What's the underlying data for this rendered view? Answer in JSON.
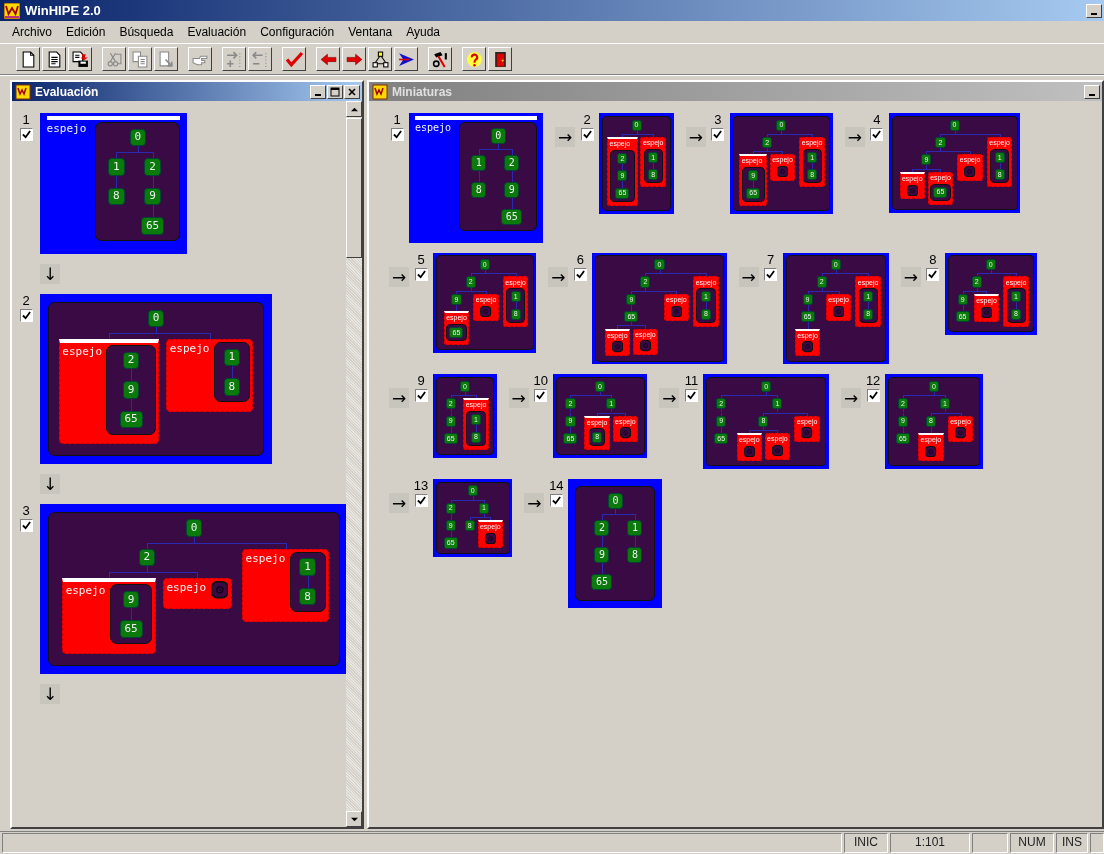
{
  "window": {
    "title": "WinHIPE 2.0"
  },
  "menu": [
    "Archivo",
    "Edición",
    "Búsqueda",
    "Evaluación",
    "Configuración",
    "Ventana",
    "Ayuda"
  ],
  "toolbar": [
    [
      {
        "kind": "new-file",
        "disabled": false
      },
      {
        "kind": "document",
        "disabled": false
      },
      {
        "kind": "save",
        "disabled": false
      }
    ],
    [
      {
        "kind": "scissors",
        "disabled": true
      },
      {
        "kind": "copy",
        "disabled": true
      },
      {
        "kind": "document-arrow",
        "disabled": true
      }
    ],
    [
      {
        "kind": "hand",
        "disabled": true
      }
    ],
    [
      {
        "kind": "plus-arrow",
        "disabled": true
      },
      {
        "kind": "minus-arrow",
        "disabled": true
      }
    ],
    [
      {
        "kind": "checkmark",
        "disabled": false
      }
    ],
    [
      {
        "kind": "left-arrow",
        "disabled": false
      },
      {
        "kind": "right-arrow",
        "disabled": false
      },
      {
        "kind": "tree",
        "disabled": false
      },
      {
        "kind": "play",
        "disabled": false
      }
    ],
    [
      {
        "kind": "tools",
        "disabled": false
      }
    ],
    [
      {
        "kind": "help",
        "disabled": false
      },
      {
        "kind": "door",
        "disabled": false
      }
    ]
  ],
  "evaluation_window": {
    "title": "Evaluación",
    "active": true,
    "steps": [
      {
        "number": "1",
        "checked": true,
        "arrow": "↓",
        "expression": {
          "kind": "espejo",
          "label": "espejo",
          "active": true,
          "arg": {
            "kind": "num",
            "text": "0",
            "children": [
              {
                "kind": "num",
                "text": "1",
                "children": [
                  {
                    "kind": "num",
                    "text": "8"
                  }
                ]
              },
              {
                "kind": "num",
                "text": "2",
                "children": [
                  {
                    "kind": "num",
                    "text": "9",
                    "children": [
                      {
                        "kind": "num",
                        "text": "65"
                      }
                    ]
                  }
                ]
              }
            ]
          }
        }
      },
      {
        "number": "2",
        "checked": true,
        "arrow": "↓",
        "expression": {
          "kind": "num",
          "text": "0",
          "children": [
            {
              "kind": "espejo",
              "label": "espejo",
              "active": true,
              "arg": {
                "kind": "num",
                "text": "2",
                "children": [
                  {
                    "kind": "num",
                    "text": "9",
                    "children": [
                      {
                        "kind": "num",
                        "text": "65"
                      }
                    ]
                  }
                ]
              }
            },
            {
              "kind": "espejo",
              "label": "espejo",
              "active": false,
              "arg": {
                "kind": "num",
                "text": "1",
                "children": [
                  {
                    "kind": "num",
                    "text": "8"
                  }
                ]
              }
            }
          ]
        }
      },
      {
        "number": "3",
        "checked": true,
        "arrow": "↓",
        "expression": {
          "kind": "num",
          "text": "0",
          "children": [
            {
              "kind": "num",
              "text": "2",
              "children": [
                {
                  "kind": "espejo",
                  "label": "espejo",
                  "active": true,
                  "arg": {
                    "kind": "num",
                    "text": "9",
                    "children": [
                      {
                        "kind": "num",
                        "text": "65"
                      }
                    ]
                  }
                },
                {
                  "kind": "espejo",
                  "label": "espejo",
                  "active": false,
                  "arg": {
                    "kind": "empty"
                  }
                }
              ]
            },
            {
              "kind": "espejo",
              "label": "espejo",
              "active": false,
              "arg": {
                "kind": "num",
                "text": "1",
                "children": [
                  {
                    "kind": "num",
                    "text": "8"
                  }
                ]
              }
            }
          ]
        }
      }
    ]
  },
  "thumbnails_window": {
    "title": "Miniaturas",
    "active": false,
    "steps": [
      {
        "number": "1",
        "checked": true,
        "expression": {
          "kind": "espejo",
          "label": "espejo",
          "active": true,
          "arg": {
            "kind": "num",
            "text": "0",
            "children": [
              {
                "kind": "num",
                "text": "1",
                "children": [
                  {
                    "kind": "num",
                    "text": "8"
                  }
                ]
              },
              {
                "kind": "num",
                "text": "2",
                "children": [
                  {
                    "kind": "num",
                    "text": "9",
                    "children": [
                      {
                        "kind": "num",
                        "text": "65"
                      }
                    ]
                  }
                ]
              }
            ]
          }
        }
      },
      {
        "arrow": "→",
        "number": "2",
        "checked": true,
        "expression": {
          "kind": "num",
          "text": "0",
          "children": [
            {
              "kind": "espejo",
              "label": "espejo",
              "active": true,
              "arg": {
                "kind": "num",
                "text": "2",
                "children": [
                  {
                    "kind": "num",
                    "text": "9",
                    "children": [
                      {
                        "kind": "num",
                        "text": "65"
                      }
                    ]
                  }
                ]
              }
            },
            {
              "kind": "espejo",
              "label": "espejo",
              "active": false,
              "arg": {
                "kind": "num",
                "text": "1",
                "children": [
                  {
                    "kind": "num",
                    "text": "8"
                  }
                ]
              }
            }
          ]
        }
      },
      {
        "arrow": "→",
        "number": "3",
        "checked": true,
        "expression": {
          "kind": "num",
          "text": "0",
          "children": [
            {
              "kind": "num",
              "text": "2",
              "children": [
                {
                  "kind": "espejo",
                  "label": "espejo",
                  "active": true,
                  "arg": {
                    "kind": "num",
                    "text": "9",
                    "children": [
                      {
                        "kind": "num",
                        "text": "65"
                      }
                    ]
                  }
                },
                {
                  "kind": "espejo",
                  "label": "espejo",
                  "active": false,
                  "arg": {
                    "kind": "empty"
                  }
                }
              ]
            },
            {
              "kind": "espejo",
              "label": "espejo",
              "active": false,
              "arg": {
                "kind": "num",
                "text": "1",
                "children": [
                  {
                    "kind": "num",
                    "text": "8"
                  }
                ]
              }
            }
          ]
        }
      },
      {
        "arrow": "→",
        "number": "4",
        "checked": true,
        "expression": {
          "kind": "num",
          "text": "0",
          "children": [
            {
              "kind": "num",
              "text": "2",
              "children": [
                {
                  "kind": "num",
                  "text": "9",
                  "children": [
                    {
                      "kind": "espejo",
                      "label": "espejo",
                      "active": true,
                      "arg": {
                        "kind": "empty"
                      }
                    },
                    {
                      "kind": "espejo",
                      "label": "espejo",
                      "active": false,
                      "arg": {
                        "kind": "num",
                        "text": "65"
                      }
                    }
                  ]
                },
                {
                  "kind": "espejo",
                  "label": "espejo",
                  "active": false,
                  "arg": {
                    "kind": "empty"
                  }
                }
              ]
            },
            {
              "kind": "espejo",
              "label": "espejo",
              "active": false,
              "arg": {
                "kind": "num",
                "text": "1",
                "children": [
                  {
                    "kind": "num",
                    "text": "8"
                  }
                ]
              }
            }
          ]
        }
      },
      {
        "arrow": "→",
        "number": "5",
        "checked": true,
        "expression": {
          "kind": "num",
          "text": "0",
          "children": [
            {
              "kind": "num",
              "text": "2",
              "children": [
                {
                  "kind": "num",
                  "text": "9",
                  "children": [
                    {
                      "kind": "espejo",
                      "label": "espejo",
                      "active": true,
                      "arg": {
                        "kind": "num",
                        "text": "65"
                      }
                    }
                  ]
                },
                {
                  "kind": "espejo",
                  "label": "espejo",
                  "active": false,
                  "arg": {
                    "kind": "empty"
                  }
                }
              ]
            },
            {
              "kind": "espejo",
              "label": "espejo",
              "active": false,
              "arg": {
                "kind": "num",
                "text": "1",
                "children": [
                  {
                    "kind": "num",
                    "text": "8"
                  }
                ]
              }
            }
          ]
        }
      },
      {
        "arrow": "→",
        "number": "6",
        "checked": true,
        "expression": {
          "kind": "num",
          "text": "0",
          "children": [
            {
              "kind": "num",
              "text": "2",
              "children": [
                {
                  "kind": "num",
                  "text": "9",
                  "children": [
                    {
                      "kind": "num",
                      "text": "65",
                      "children": [
                        {
                          "kind": "espejo",
                          "label": "espejo",
                          "active": true,
                          "arg": {
                            "kind": "empty"
                          }
                        },
                        {
                          "kind": "espejo",
                          "label": "espejo",
                          "active": false,
                          "arg": {
                            "kind": "empty"
                          }
                        }
                      ]
                    }
                  ]
                },
                {
                  "kind": "espejo",
                  "label": "espejo",
                  "active": false,
                  "arg": {
                    "kind": "empty"
                  }
                }
              ]
            },
            {
              "kind": "espejo",
              "label": "espejo",
              "active": false,
              "arg": {
                "kind": "num",
                "text": "1",
                "children": [
                  {
                    "kind": "num",
                    "text": "8"
                  }
                ]
              }
            }
          ]
        }
      },
      {
        "arrow": "→",
        "number": "7",
        "checked": true,
        "expression": {
          "kind": "num",
          "text": "0",
          "children": [
            {
              "kind": "num",
              "text": "2",
              "children": [
                {
                  "kind": "num",
                  "text": "9",
                  "children": [
                    {
                      "kind": "num",
                      "text": "65",
                      "children": [
                        {
                          "kind": "espejo",
                          "label": "espejo",
                          "active": true,
                          "arg": {
                            "kind": "empty"
                          }
                        }
                      ]
                    }
                  ]
                },
                {
                  "kind": "espejo",
                  "label": "espejo",
                  "active": false,
                  "arg": {
                    "kind": "empty"
                  }
                }
              ]
            },
            {
              "kind": "espejo",
              "label": "espejo",
              "active": false,
              "arg": {
                "kind": "num",
                "text": "1",
                "children": [
                  {
                    "kind": "num",
                    "text": "8"
                  }
                ]
              }
            }
          ]
        }
      },
      {
        "arrow": "→",
        "number": "8",
        "checked": true,
        "expression": {
          "kind": "num",
          "text": "0",
          "children": [
            {
              "kind": "num",
              "text": "2",
              "children": [
                {
                  "kind": "num",
                  "text": "9",
                  "children": [
                    {
                      "kind": "num",
                      "text": "65"
                    }
                  ]
                },
                {
                  "kind": "espejo",
                  "label": "espejo",
                  "active": true,
                  "arg": {
                    "kind": "empty"
                  }
                }
              ]
            },
            {
              "kind": "espejo",
              "label": "espejo",
              "active": false,
              "arg": {
                "kind": "num",
                "text": "1",
                "children": [
                  {
                    "kind": "num",
                    "text": "8"
                  }
                ]
              }
            }
          ]
        }
      },
      {
        "arrow": "→",
        "number": "9",
        "checked": true,
        "expression": {
          "kind": "num",
          "text": "0",
          "children": [
            {
              "kind": "num",
              "text": "2",
              "children": [
                {
                  "kind": "num",
                  "text": "9",
                  "children": [
                    {
                      "kind": "num",
                      "text": "65"
                    }
                  ]
                }
              ]
            },
            {
              "kind": "espejo",
              "label": "espejo",
              "active": true,
              "arg": {
                "kind": "num",
                "text": "1",
                "children": [
                  {
                    "kind": "num",
                    "text": "8"
                  }
                ]
              }
            }
          ]
        }
      },
      {
        "arrow": "→",
        "number": "10",
        "checked": true,
        "expression": {
          "kind": "num",
          "text": "0",
          "children": [
            {
              "kind": "num",
              "text": "2",
              "children": [
                {
                  "kind": "num",
                  "text": "9",
                  "children": [
                    {
                      "kind": "num",
                      "text": "65"
                    }
                  ]
                }
              ]
            },
            {
              "kind": "num",
              "text": "1",
              "children": [
                {
                  "kind": "espejo",
                  "label": "espejo",
                  "active": true,
                  "arg": {
                    "kind": "num",
                    "text": "8"
                  }
                },
                {
                  "kind": "espejo",
                  "label": "espejo",
                  "active": false,
                  "arg": {
                    "kind": "empty"
                  }
                }
              ]
            }
          ]
        }
      },
      {
        "arrow": "→",
        "number": "11",
        "checked": true,
        "expression": {
          "kind": "num",
          "text": "0",
          "children": [
            {
              "kind": "num",
              "text": "2",
              "children": [
                {
                  "kind": "num",
                  "text": "9",
                  "children": [
                    {
                      "kind": "num",
                      "text": "65"
                    }
                  ]
                }
              ]
            },
            {
              "kind": "num",
              "text": "1",
              "children": [
                {
                  "kind": "num",
                  "text": "8",
                  "children": [
                    {
                      "kind": "espejo",
                      "label": "espejo",
                      "active": true,
                      "arg": {
                        "kind": "empty"
                      }
                    },
                    {
                      "kind": "espejo",
                      "label": "espejo",
                      "active": false,
                      "arg": {
                        "kind": "empty"
                      }
                    }
                  ]
                },
                {
                  "kind": "espejo",
                  "label": "espejo",
                  "active": false,
                  "arg": {
                    "kind": "empty"
                  }
                }
              ]
            }
          ]
        }
      },
      {
        "arrow": "→",
        "number": "12",
        "checked": true,
        "expression": {
          "kind": "num",
          "text": "0",
          "children": [
            {
              "kind": "num",
              "text": "2",
              "children": [
                {
                  "kind": "num",
                  "text": "9",
                  "children": [
                    {
                      "kind": "num",
                      "text": "65"
                    }
                  ]
                }
              ]
            },
            {
              "kind": "num",
              "text": "1",
              "children": [
                {
                  "kind": "num",
                  "text": "8",
                  "children": [
                    {
                      "kind": "espejo",
                      "label": "espejo",
                      "active": true,
                      "arg": {
                        "kind": "empty"
                      }
                    }
                  ]
                },
                {
                  "kind": "espejo",
                  "label": "espejo",
                  "active": false,
                  "arg": {
                    "kind": "empty"
                  }
                }
              ]
            }
          ]
        }
      },
      {
        "arrow": "→",
        "number": "13",
        "checked": true,
        "expression": {
          "kind": "num",
          "text": "0",
          "children": [
            {
              "kind": "num",
              "text": "2",
              "children": [
                {
                  "kind": "num",
                  "text": "9",
                  "children": [
                    {
                      "kind": "num",
                      "text": "65"
                    }
                  ]
                }
              ]
            },
            {
              "kind": "num",
              "text": "1",
              "children": [
                {
                  "kind": "num",
                  "text": "8"
                },
                {
                  "kind": "espejo",
                  "label": "espejo",
                  "active": true,
                  "arg": {
                    "kind": "empty"
                  }
                }
              ]
            }
          ]
        }
      },
      {
        "arrow": "→",
        "number": "14",
        "checked": true,
        "expression": {
          "kind": "num",
          "text": "0",
          "children": [
            {
              "kind": "num",
              "text": "2",
              "children": [
                {
                  "kind": "num",
                  "text": "9",
                  "children": [
                    {
                      "kind": "num",
                      "text": "65"
                    }
                  ]
                }
              ]
            },
            {
              "kind": "num",
              "text": "1",
              "children": [
                {
                  "kind": "num",
                  "text": "8"
                }
              ]
            }
          ]
        }
      }
    ]
  },
  "status_bar": [
    {
      "kind": "blank"
    },
    {
      "kind": "text",
      "text": "INIC"
    },
    {
      "kind": "text",
      "text": "1:101"
    },
    {
      "kind": "blank"
    },
    {
      "kind": "text",
      "text": "NUM"
    },
    {
      "kind": "text",
      "text": "INS"
    },
    {
      "kind": "blank"
    }
  ]
}
